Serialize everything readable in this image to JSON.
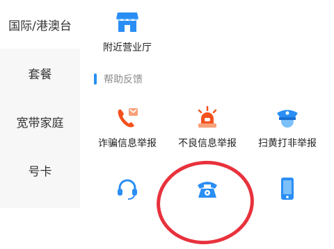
{
  "sidebar": {
    "items": [
      {
        "label": "国际/港澳台"
      },
      {
        "label": "套餐"
      },
      {
        "label": "宽带家庭"
      },
      {
        "label": "号卡"
      },
      {
        "label": ""
      }
    ]
  },
  "main": {
    "nearby_tile": {
      "label": "附近营业厅",
      "icon": "storefront-icon"
    },
    "help_section": {
      "title": "帮助反馈"
    },
    "tiles": [
      {
        "label": "诈骗信息举报",
        "icon": "phone-report-icon"
      },
      {
        "label": "不良信息举报",
        "icon": "siren-icon"
      },
      {
        "label": "扫黄打非举报",
        "icon": "police-cap-icon"
      },
      {
        "label": "",
        "icon": "headset-icon"
      },
      {
        "label": "",
        "icon": "telephone-icon"
      },
      {
        "label": "",
        "icon": "smartphone-icon"
      }
    ]
  },
  "colors": {
    "accent_blue": "#2a8ef4",
    "alert_red": "#f4511e",
    "annotation_red": "#e8323c",
    "sidebar_bg": "#f7f7f7"
  }
}
